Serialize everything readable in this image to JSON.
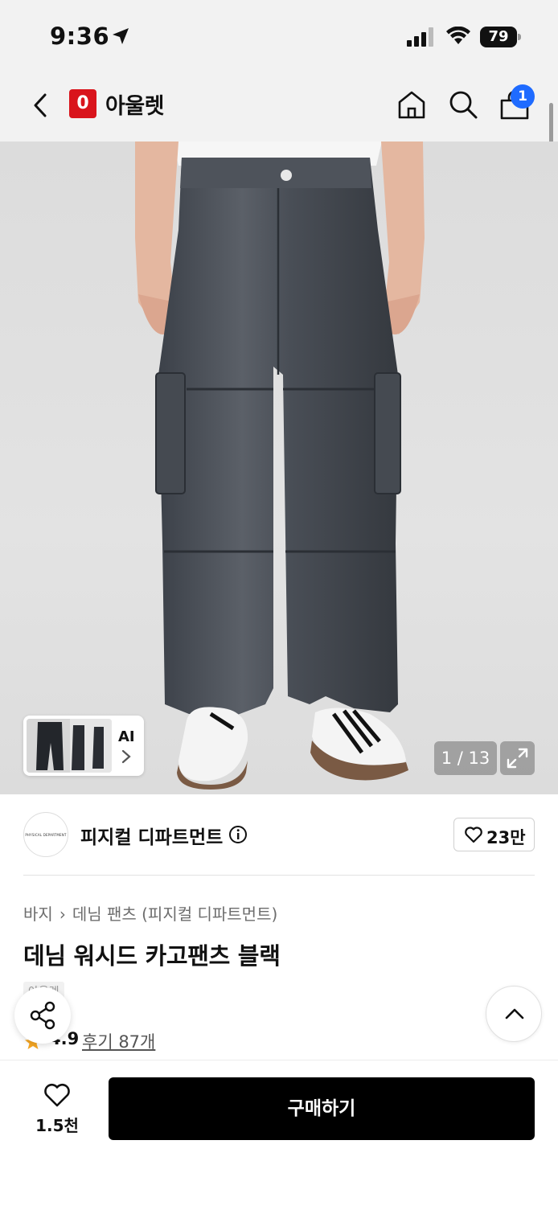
{
  "status_bar": {
    "time": "9:36",
    "battery": "79"
  },
  "nav": {
    "logo_mark": "0",
    "store_name": "아울렛",
    "cart_count": "1"
  },
  "gallery": {
    "counter": "1 / 13",
    "ai_label": "AI"
  },
  "brand": {
    "logo_text": "PHYSICAL DEPARTMENT",
    "name": "피지컬 디파트먼트",
    "like_count": "23만"
  },
  "product": {
    "breadcrumb": [
      "바지",
      "데님 팬츠 (피지컬 디파트먼트)"
    ],
    "title": "데님 워시드 카고팬츠 블랙",
    "tag": "아울렛",
    "rating": "4.9",
    "reviews": "후기 87개"
  },
  "bottom_bar": {
    "wish_count": "1.5천",
    "buy_label": "구매하기"
  },
  "colors": {
    "accent_red": "#d9141c",
    "badge_blue": "#1f6bff",
    "buy_button": "#000000",
    "star": "#f5a623"
  },
  "icons": [
    "location-arrow-icon",
    "signal-icon",
    "wifi-icon",
    "battery-icon",
    "back-chevron-icon",
    "home-icon",
    "search-icon",
    "cart-icon",
    "chevron-right-icon",
    "expand-icon",
    "info-icon",
    "heart-icon",
    "star-icon",
    "share-icon",
    "chevron-up-icon"
  ]
}
